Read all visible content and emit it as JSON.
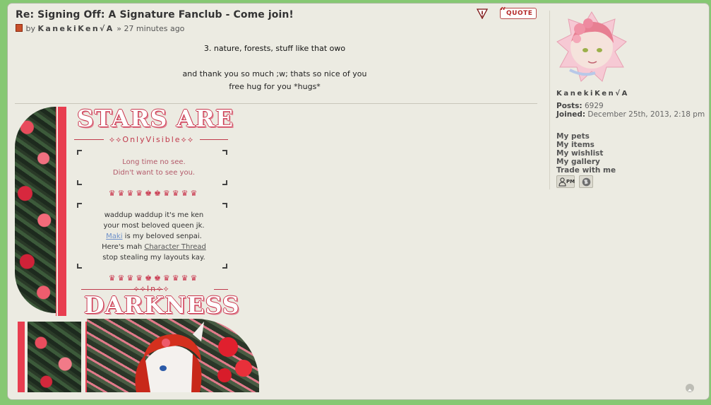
{
  "post": {
    "title": "Re: Signing Off: A Signature Fanclub - Come join!",
    "by_prefix": "by",
    "author": "KanekiKen√A",
    "separator": "»",
    "time": "27 minutes ago",
    "quote_label": "QUOTE",
    "body": [
      "3. nature, forests, stuff like that owo",
      "and thank you so much ;w; thats so nice of you",
      "free hug for you *hugs*"
    ]
  },
  "signature": {
    "title_top": "STARS ARE",
    "tagline_top": "⟡⟡OnlyVisible⟡⟡",
    "greeting_lines": [
      "Long time no see.",
      "Didn't want to see you."
    ],
    "crowns": "♛♛♛♛♚♚♛♛♛♛",
    "intro_lines": [
      "waddup waddup it's me ken",
      "your most beloved queen jk."
    ],
    "maki_link": "Maki",
    "maki_suffix": " is my beloved senpai.",
    "thread_prefix": "Here's mah ",
    "thread_link": "Character Thread",
    "last_line": "stop stealing my layouts kay.",
    "tagline_bottom": "⟡⟡In⟡⟡",
    "title_bottom": "DARKNESS"
  },
  "profile": {
    "username": "KanekiKen√A",
    "posts_label": "Posts:",
    "posts_value": "6929",
    "joined_label": "Joined:",
    "joined_value": "December 25th, 2013, 2:18 pm",
    "links": [
      "My pets",
      "My items",
      "My wishlist",
      "My gallery",
      "Trade with me"
    ],
    "pm_label": "PM"
  },
  "colors": {
    "background": "#86c873",
    "panel": "#ecebe2",
    "accent": "#e83e50"
  },
  "icons": [
    "post-icon",
    "report-icon",
    "quote-icon",
    "pm-icon",
    "website-icon",
    "back-to-top-icon"
  ]
}
